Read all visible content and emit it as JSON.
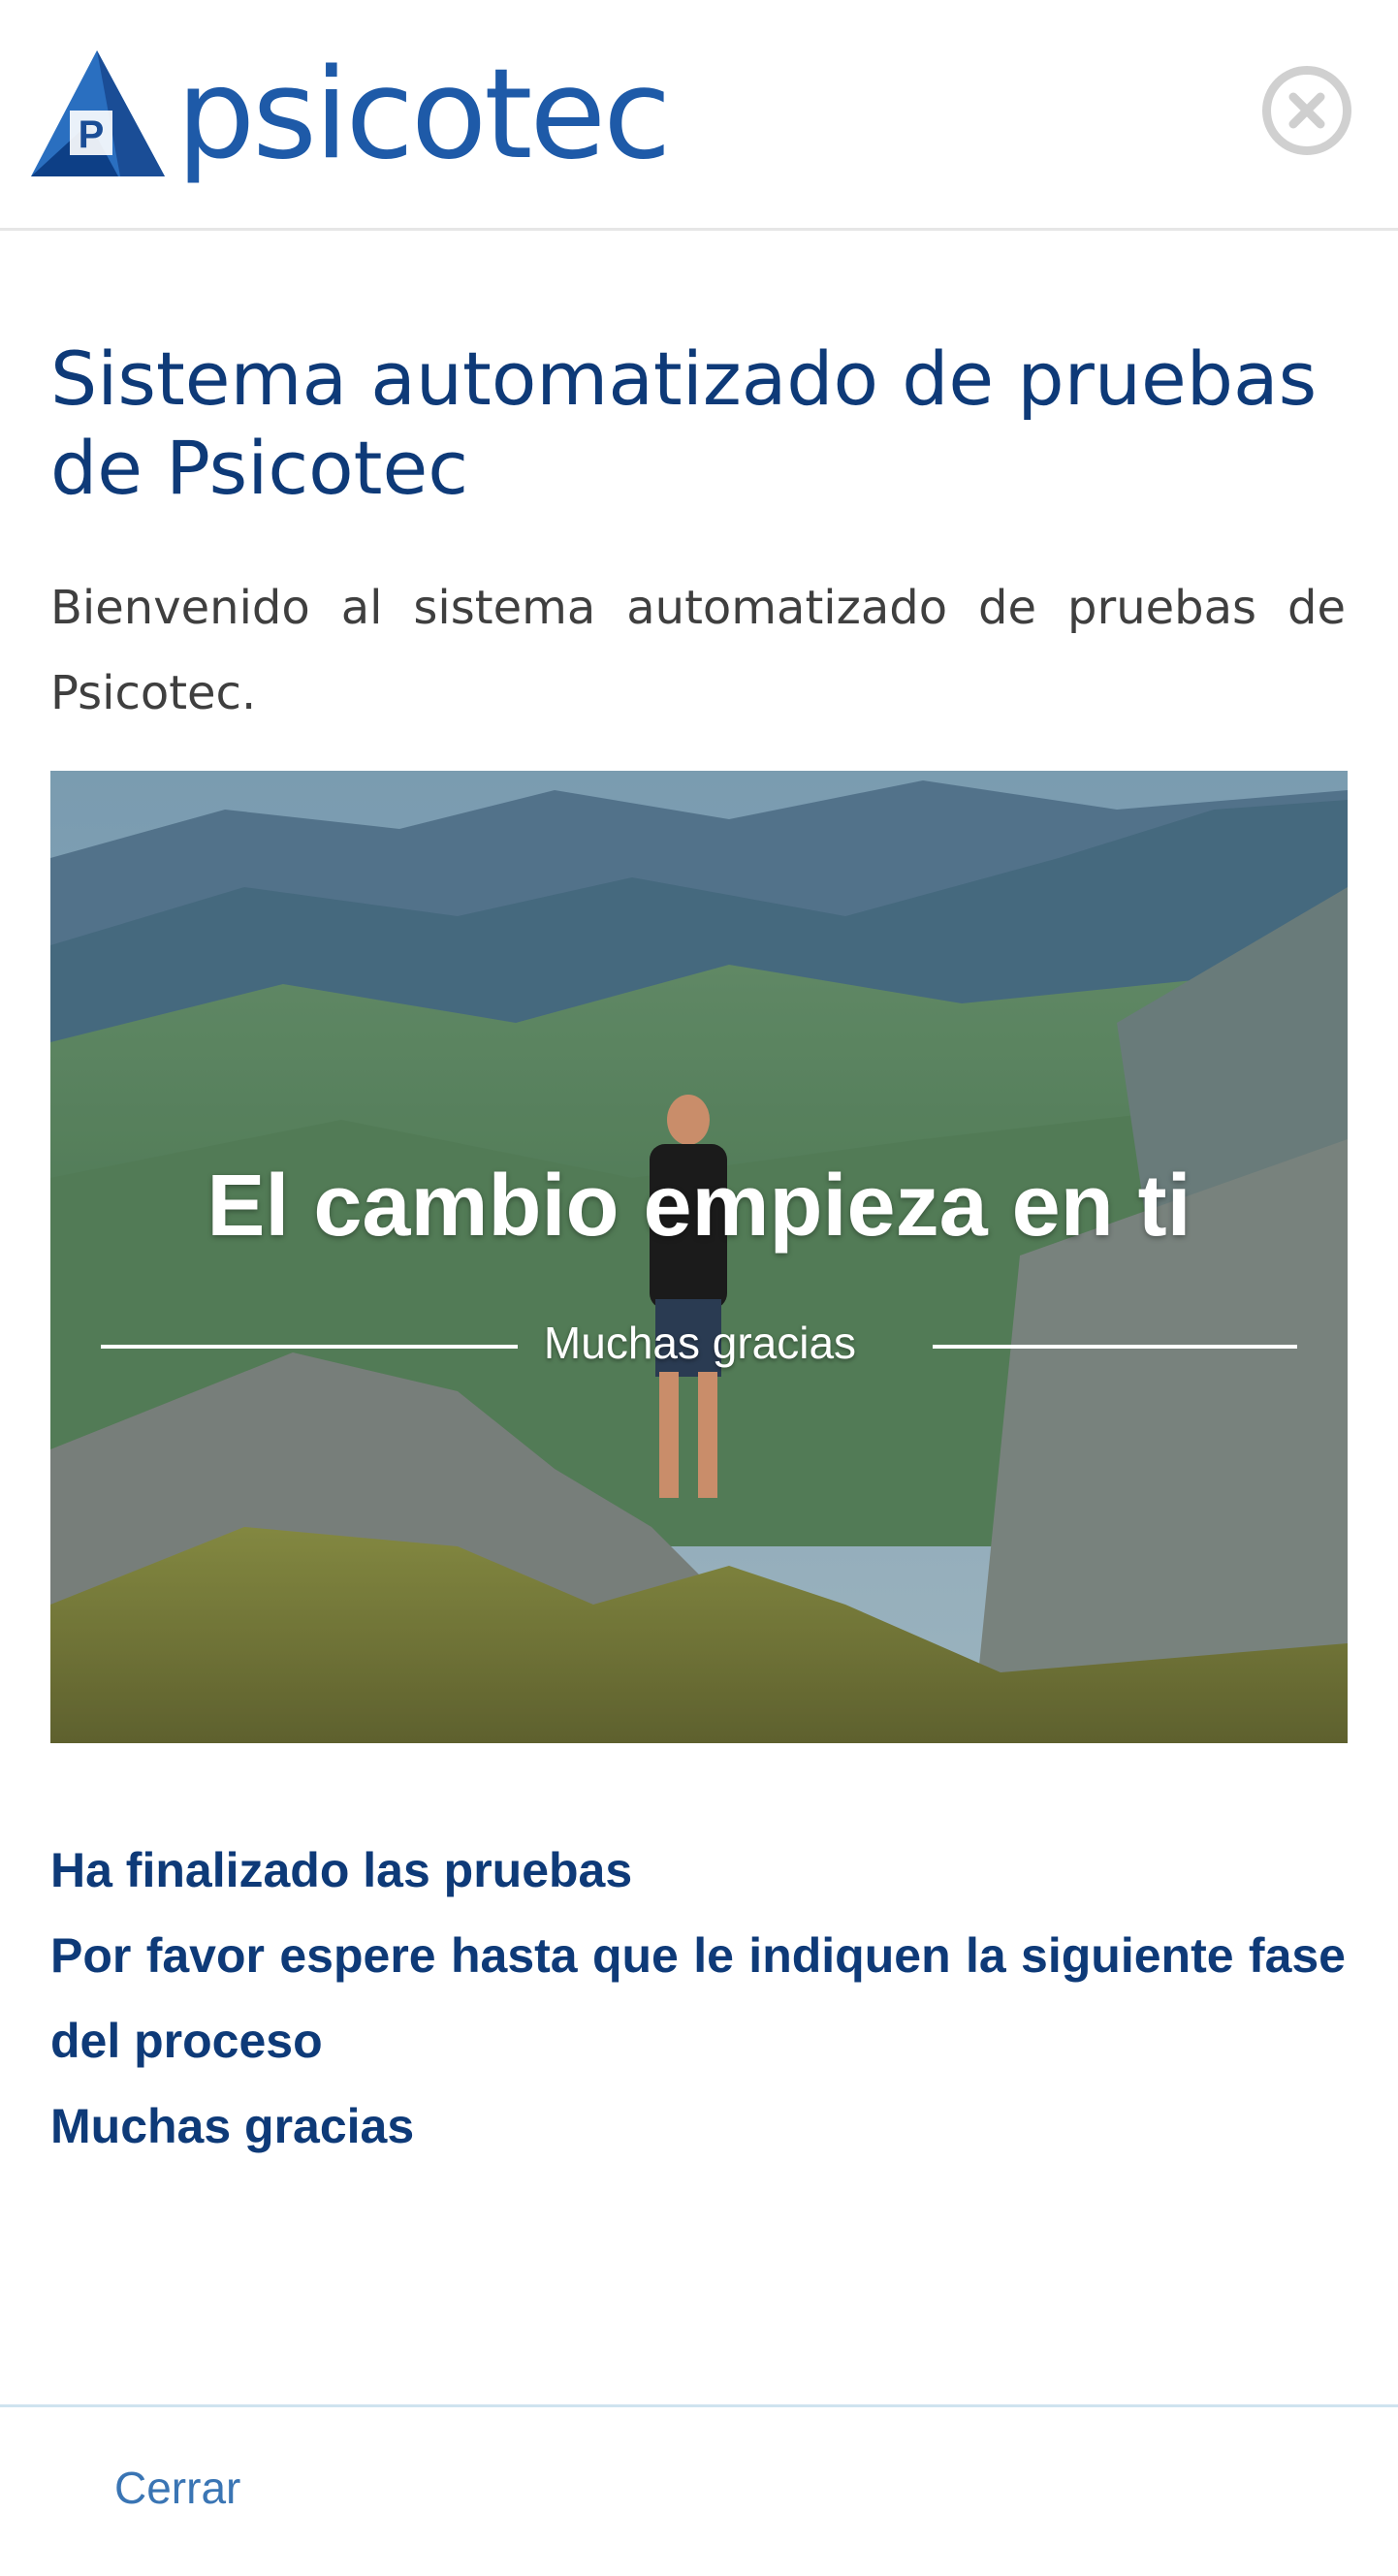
{
  "header": {
    "logo_text": "psicotec",
    "logo_mark_letter": "P",
    "close_icon": "close-circle-icon"
  },
  "main": {
    "title": "Sistema automatizado de pruebas de Psicotec",
    "intro": "Bienvenido al sistema automatizado de pruebas de Psicotec.",
    "banner": {
      "headline": "El cambio empieza en ti",
      "subtitle": "Muchas gracias"
    },
    "message": {
      "line1": "Ha finalizado las pruebas",
      "line2": "Por favor espere hasta que le indiquen la siguiente fase del proceso",
      "line3": "Muchas gracias"
    }
  },
  "footer": {
    "close_label": "Cerrar"
  },
  "colors": {
    "brand_blue": "#1e5aa8",
    "title_blue": "#0e3a78",
    "link_blue": "#3a75b4"
  }
}
